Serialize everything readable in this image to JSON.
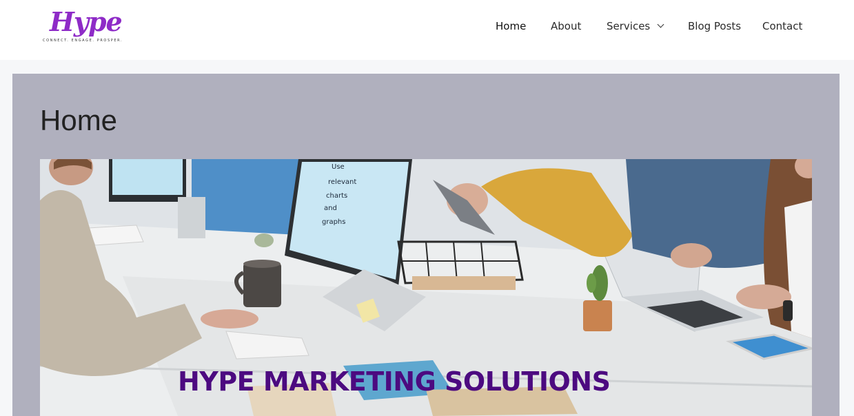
{
  "header": {
    "logo": {
      "word": "Hype",
      "tagline": "CONNECT. ENGAGE. PROSPER."
    },
    "nav": [
      {
        "label": "Home",
        "current": true
      },
      {
        "label": "About"
      },
      {
        "label": "Services",
        "has_dropdown": true
      },
      {
        "label": "Blog Posts"
      },
      {
        "label": "Contact"
      }
    ]
  },
  "main": {
    "page_title": "Home",
    "hero": {
      "title": "HYPE MARKETING SOLUTIONS",
      "screen_text": [
        "Use",
        "relevant",
        "charts",
        "and",
        "graphs"
      ]
    }
  },
  "colors": {
    "brand": "#8e2bc7",
    "hero_title": "#4c0a80",
    "content_bg": "#b0b0be"
  }
}
